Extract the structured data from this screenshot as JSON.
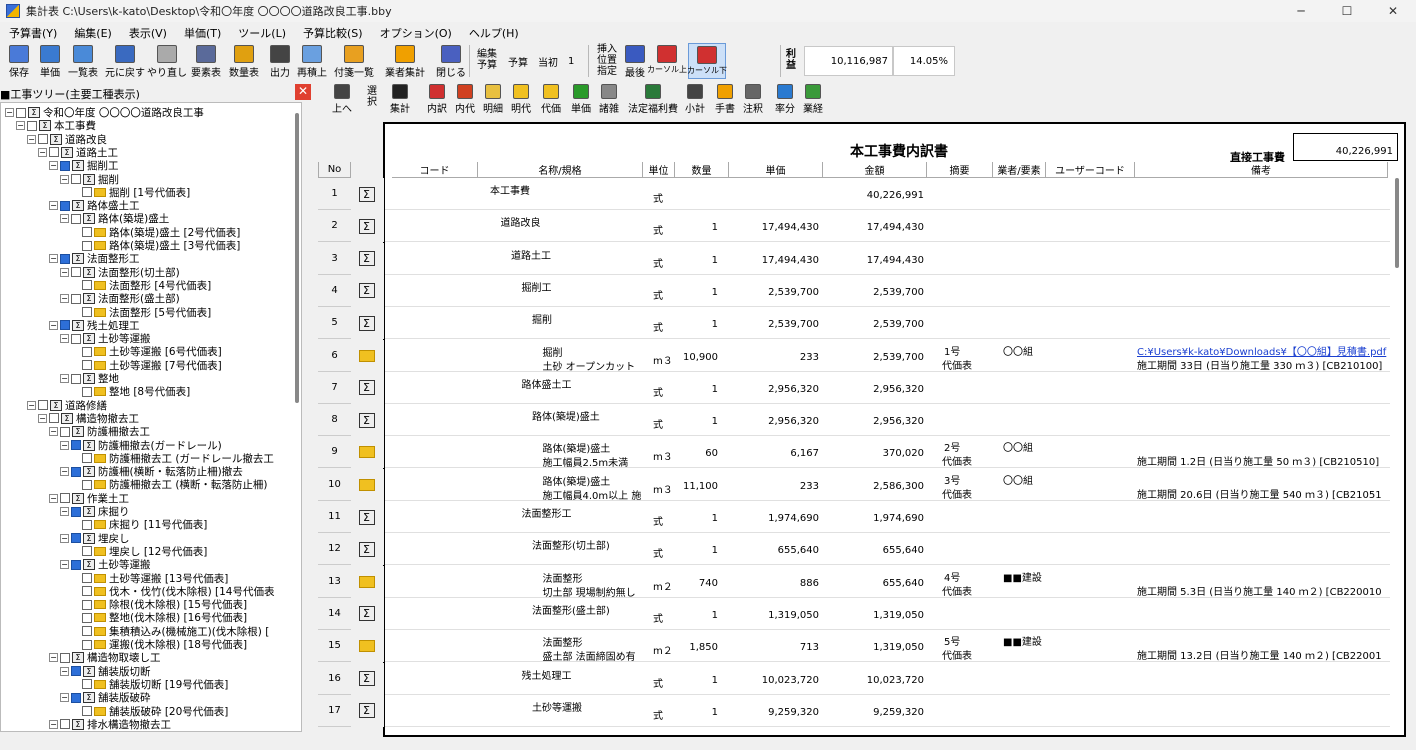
{
  "window": {
    "title": "集計表  C:\\Users\\k-kato\\Desktop\\令和〇年度  〇〇〇〇道路改良工事.bby"
  },
  "menu": [
    "予算書(Y)",
    "編集(E)",
    "表示(V)",
    "単価(T)",
    "ツール(L)",
    "予算比較(S)",
    "オプション(O)",
    "ヘルプ(H)"
  ],
  "toolbar1": {
    "buttons": [
      {
        "l": "保存"
      },
      {
        "l": "単価"
      },
      {
        "l": "一覧表"
      },
      {
        "l": "元に戻す"
      },
      {
        "l": "やり直し"
      },
      {
        "l": "要素表"
      },
      {
        "l": "数量表"
      },
      {
        "l": "出力"
      },
      {
        "l": "再積上"
      },
      {
        "l": "付箋一覧"
      },
      {
        "l": "業者集計"
      },
      {
        "l": "閉じる"
      }
    ],
    "edit_label": "編集\n予算",
    "budget_label": "予算",
    "initial_label": "当初",
    "initial_value": "1",
    "insert_label": "挿入\n位置\n指定",
    "last_label": "最後",
    "cursor_up": "カーソル上",
    "cursor_down": "カーソル下",
    "profit_label": "利\n益",
    "profit_value": "10,116,987",
    "profit_rate": "14.05%"
  },
  "toolbar2": {
    "buttons": [
      "上へ",
      "選\n択",
      "集計",
      "内訳",
      "内代",
      "明細",
      "明代",
      "代価",
      "単価",
      "諸雑",
      "法定福利費",
      "小計",
      "手書",
      "注釈",
      "率分",
      "業経"
    ]
  },
  "tree": {
    "title": "■工事ツリー(主要工種表示)",
    "close": "✕",
    "nodes": [
      {
        "l": "令和〇年度  〇〇〇〇道路改良工事",
        "d": 0,
        "k": "sg",
        "c": false
      },
      {
        "l": "本工事費",
        "d": 1,
        "k": "sg",
        "c": false
      },
      {
        "l": "道路改良",
        "d": 2,
        "k": "sg",
        "c": false
      },
      {
        "l": "道路土工",
        "d": 3,
        "k": "sg",
        "c": false
      },
      {
        "l": "掘削工",
        "d": 4,
        "k": "sg",
        "c": true
      },
      {
        "l": "掘削",
        "d": 5,
        "k": "sg",
        "c": false
      },
      {
        "l": "掘削 [1号代価表]",
        "d": 6,
        "k": "fd",
        "c": false
      },
      {
        "l": "路体盛土工",
        "d": 4,
        "k": "sg",
        "c": true
      },
      {
        "l": "路体(築堤)盛土",
        "d": 5,
        "k": "sg",
        "c": false
      },
      {
        "l": "路体(築堤)盛土 [2号代価表]",
        "d": 6,
        "k": "fd",
        "c": false
      },
      {
        "l": "路体(築堤)盛土 [3号代価表]",
        "d": 6,
        "k": "fd",
        "c": false
      },
      {
        "l": "法面整形工",
        "d": 4,
        "k": "sg",
        "c": true
      },
      {
        "l": "法面整形(切土部)",
        "d": 5,
        "k": "sg",
        "c": false
      },
      {
        "l": "法面整形 [4号代価表]",
        "d": 6,
        "k": "fd",
        "c": false
      },
      {
        "l": "法面整形(盛土部)",
        "d": 5,
        "k": "sg",
        "c": false
      },
      {
        "l": "法面整形 [5号代価表]",
        "d": 6,
        "k": "fd",
        "c": false
      },
      {
        "l": "残土処理工",
        "d": 4,
        "k": "sg",
        "c": true
      },
      {
        "l": "土砂等運搬",
        "d": 5,
        "k": "sg",
        "c": false
      },
      {
        "l": "土砂等運搬 [6号代価表]",
        "d": 6,
        "k": "fd",
        "c": false
      },
      {
        "l": "土砂等運搬 [7号代価表]",
        "d": 6,
        "k": "fd",
        "c": false
      },
      {
        "l": "整地",
        "d": 5,
        "k": "sg",
        "c": false
      },
      {
        "l": "整地 [8号代価表]",
        "d": 6,
        "k": "fd",
        "c": false
      },
      {
        "l": "道路修繕",
        "d": 2,
        "k": "sg",
        "c": false
      },
      {
        "l": "構造物撤去工",
        "d": 3,
        "k": "sg",
        "c": false
      },
      {
        "l": "防護柵撤去工",
        "d": 4,
        "k": "sg",
        "c": false
      },
      {
        "l": "防護柵撤去(ガードレール)",
        "d": 5,
        "k": "sg",
        "c": true
      },
      {
        "l": "防護柵撤去工 (ガードレール撤去工",
        "d": 6,
        "k": "fd",
        "c": false
      },
      {
        "l": "防護柵(横断・転落防止柵)撤去",
        "d": 5,
        "k": "sg",
        "c": true
      },
      {
        "l": "防護柵撤去工 (横断・転落防止柵)",
        "d": 6,
        "k": "fd",
        "c": false
      },
      {
        "l": "作業土工",
        "d": 4,
        "k": "sg",
        "c": false
      },
      {
        "l": "床掘り",
        "d": 5,
        "k": "sg",
        "c": true
      },
      {
        "l": "床掘り [11号代価表]",
        "d": 6,
        "k": "fd",
        "c": false
      },
      {
        "l": "埋戻し",
        "d": 5,
        "k": "sg",
        "c": true
      },
      {
        "l": "埋戻し [12号代価表]",
        "d": 6,
        "k": "fd",
        "c": false
      },
      {
        "l": "土砂等運搬",
        "d": 5,
        "k": "sg",
        "c": true
      },
      {
        "l": "土砂等運搬 [13号代価表]",
        "d": 6,
        "k": "fd",
        "c": false
      },
      {
        "l": "伐木・伐竹(伐木除根) [14号代価表",
        "d": 6,
        "k": "fd",
        "c": false
      },
      {
        "l": "除根(伐木除根) [15号代価表]",
        "d": 6,
        "k": "fd",
        "c": false
      },
      {
        "l": "整地(伐木除根) [16号代価表]",
        "d": 6,
        "k": "fd",
        "c": false
      },
      {
        "l": "集積積込み(機械施工)(伐木除根) [",
        "d": 6,
        "k": "fd",
        "c": false
      },
      {
        "l": "運搬(伐木除根) [18号代価表]",
        "d": 6,
        "k": "fd",
        "c": false
      },
      {
        "l": "構造物取壊し工",
        "d": 4,
        "k": "sg",
        "c": false
      },
      {
        "l": "舗装版切断",
        "d": 5,
        "k": "sg",
        "c": true
      },
      {
        "l": "舗装版切断 [19号代価表]",
        "d": 6,
        "k": "fd",
        "c": false
      },
      {
        "l": "舗装版破砕",
        "d": 5,
        "k": "sg",
        "c": true
      },
      {
        "l": "舗装版破砕 [20号代価表]",
        "d": 6,
        "k": "fd",
        "c": false
      },
      {
        "l": "排水構造物撤去工",
        "d": 4,
        "k": "sg",
        "c": false
      }
    ]
  },
  "doc": {
    "title": "本工事費内訳書",
    "direct_label": "直接工事費",
    "direct_value": "40,226,991",
    "headers": [
      "No",
      "コード",
      "名称/規格",
      "単位",
      "数量",
      "単価",
      "金額",
      "摘要",
      "業者/要素",
      "ユーザーコード",
      "備考"
    ],
    "rows": [
      {
        "no": "1",
        "k": "sg",
        "n1": "本工事費",
        "n2": "",
        "ind": 0,
        "u": "式",
        "q": "",
        "p": "",
        "a": "40,226,991",
        "t1": "",
        "t2": "",
        "v": "",
        "r1": "",
        "r2": ""
      },
      {
        "no": "2",
        "k": "sg",
        "n1": "道路改良",
        "n2": "",
        "ind": 1,
        "u": "式",
        "q": "1",
        "p": "17,494,430",
        "a": "17,494,430",
        "t1": "",
        "t2": "",
        "v": "",
        "r1": "",
        "r2": ""
      },
      {
        "no": "3",
        "k": "sg",
        "n1": "道路土工",
        "n2": "",
        "ind": 2,
        "u": "式",
        "q": "1",
        "p": "17,494,430",
        "a": "17,494,430",
        "t1": "",
        "t2": "",
        "v": "",
        "r1": "",
        "r2": ""
      },
      {
        "no": "4",
        "k": "sg",
        "n1": "掘削工",
        "n2": "",
        "ind": 3,
        "u": "式",
        "q": "1",
        "p": "2,539,700",
        "a": "2,539,700",
        "t1": "",
        "t2": "",
        "v": "",
        "r1": "",
        "r2": ""
      },
      {
        "no": "5",
        "k": "sg",
        "n1": "掘削",
        "n2": "",
        "ind": 4,
        "u": "式",
        "q": "1",
        "p": "2,539,700",
        "a": "2,539,700",
        "t1": "",
        "t2": "",
        "v": "",
        "r1": "",
        "r2": ""
      },
      {
        "no": "6",
        "k": "fd",
        "n1": "掘削",
        "n2": "土砂 オープンカット",
        "ind": 5,
        "u": "m３",
        "q": "10,900",
        "p": "233",
        "a": "2,539,700",
        "t1": "1号",
        "t2": "代価表",
        "v": "〇〇組",
        "r1": "C:¥Users¥k-kato¥Downloads¥【〇〇組】見積書.pdf",
        "r2": "施工期間 33日 (日当り施工量 330 ｍ３) [CB210100]",
        "link": true
      },
      {
        "no": "7",
        "k": "sg",
        "n1": "路体盛土工",
        "n2": "",
        "ind": 3,
        "u": "式",
        "q": "1",
        "p": "2,956,320",
        "a": "2,956,320",
        "t1": "",
        "t2": "",
        "v": "",
        "r1": "",
        "r2": ""
      },
      {
        "no": "8",
        "k": "sg",
        "n1": "路体(築堤)盛土",
        "n2": "",
        "ind": 4,
        "u": "式",
        "q": "1",
        "p": "2,956,320",
        "a": "2,956,320",
        "t1": "",
        "t2": "",
        "v": "",
        "r1": "",
        "r2": ""
      },
      {
        "no": "9",
        "k": "fd",
        "n1": "路体(築堤)盛土",
        "n2": "施工幅員2.5m未満",
        "ind": 5,
        "u": "m３",
        "q": "60",
        "p": "6,167",
        "a": "370,020",
        "t1": "2号",
        "t2": "代価表",
        "v": "〇〇組",
        "r1": "",
        "r2": "施工期間 1.2日 (日当り施工量 50 ｍ３) [CB210510]"
      },
      {
        "no": "10",
        "k": "fd",
        "n1": "路体(築堤)盛土",
        "n2": "施工幅員4.0m以上 施",
        "ind": 5,
        "u": "m３",
        "q": "11,100",
        "p": "233",
        "a": "2,586,300",
        "t1": "3号",
        "t2": "代価表",
        "v": "〇〇組",
        "r1": "",
        "r2": "施工期間 20.6日 (日当り施工量 540 ｍ３) [CB21051"
      },
      {
        "no": "11",
        "k": "sg",
        "n1": "法面整形工",
        "n2": "",
        "ind": 3,
        "u": "式",
        "q": "1",
        "p": "1,974,690",
        "a": "1,974,690",
        "t1": "",
        "t2": "",
        "v": "",
        "r1": "",
        "r2": ""
      },
      {
        "no": "12",
        "k": "sg",
        "n1": "法面整形(切土部)",
        "n2": "",
        "ind": 4,
        "u": "式",
        "q": "1",
        "p": "655,640",
        "a": "655,640",
        "t1": "",
        "t2": "",
        "v": "",
        "r1": "",
        "r2": ""
      },
      {
        "no": "13",
        "k": "fd",
        "n1": "法面整形",
        "n2": "切土部 現場制約無し",
        "ind": 5,
        "u": "m２",
        "q": "740",
        "p": "886",
        "a": "655,640",
        "t1": "4号",
        "t2": "代価表",
        "v": "■■建設",
        "r1": "",
        "r2": "施工期間 5.3日 (日当り施工量 140 ｍ２) [CB220010"
      },
      {
        "no": "14",
        "k": "sg",
        "n1": "法面整形(盛土部)",
        "n2": "",
        "ind": 4,
        "u": "式",
        "q": "1",
        "p": "1,319,050",
        "a": "1,319,050",
        "t1": "",
        "t2": "",
        "v": "",
        "r1": "",
        "r2": ""
      },
      {
        "no": "15",
        "k": "fd",
        "n1": "法面整形",
        "n2": "盛土部 法面締固め有",
        "ind": 5,
        "u": "m２",
        "q": "1,850",
        "p": "713",
        "a": "1,319,050",
        "t1": "5号",
        "t2": "代価表",
        "v": "■■建設",
        "r1": "",
        "r2": "施工期間 13.2日 (日当り施工量 140 ｍ２) [CB22001"
      },
      {
        "no": "16",
        "k": "sg",
        "n1": "残土処理工",
        "n2": "",
        "ind": 3,
        "u": "式",
        "q": "1",
        "p": "10,023,720",
        "a": "10,023,720",
        "t1": "",
        "t2": "",
        "v": "",
        "r1": "",
        "r2": ""
      },
      {
        "no": "17",
        "k": "sg",
        "n1": "土砂等運搬",
        "n2": "",
        "ind": 4,
        "u": "式",
        "q": "1",
        "p": "9,259,320",
        "a": "9,259,320",
        "t1": "",
        "t2": "",
        "v": "",
        "r1": "",
        "r2": ""
      }
    ]
  }
}
